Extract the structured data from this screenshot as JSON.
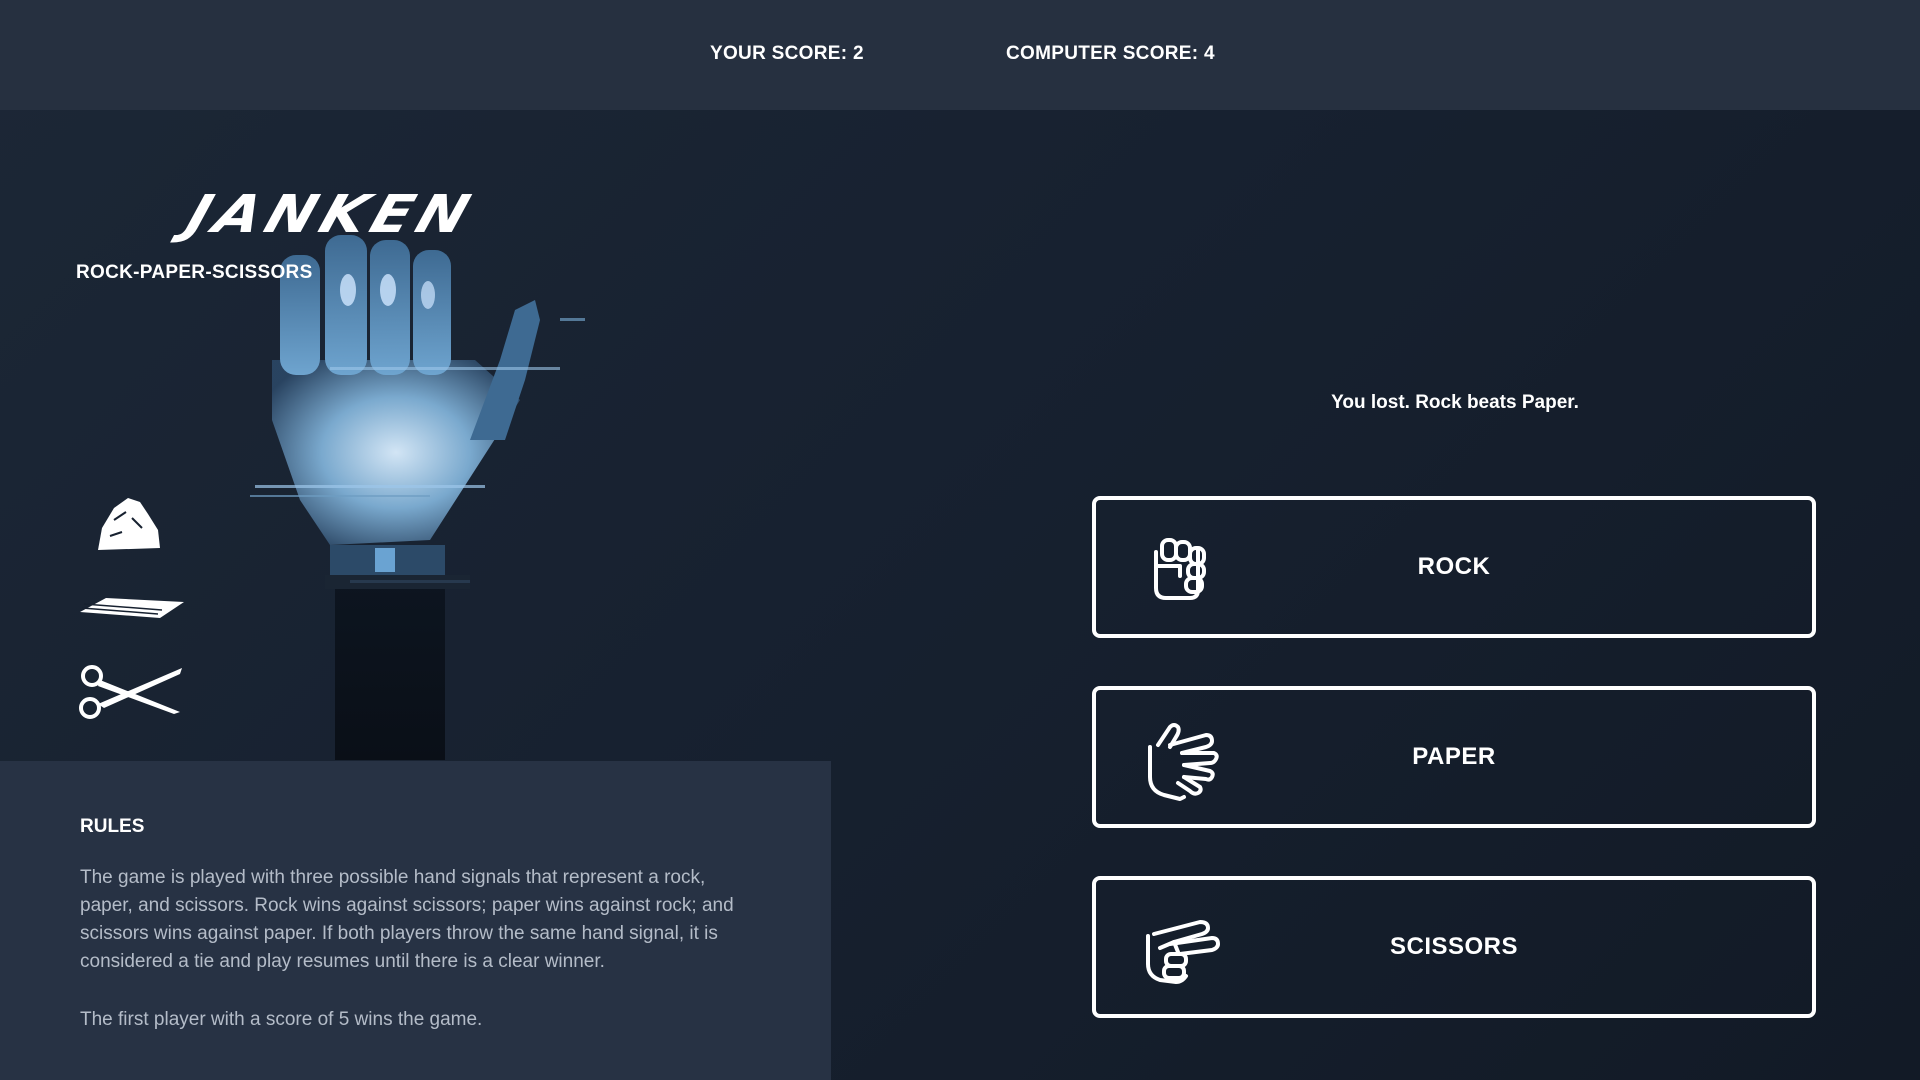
{
  "header": {
    "your_score_label": "YOUR SCORE: 2",
    "computer_score_label": "COMPUTER SCORE: 4"
  },
  "hero": {
    "logo_text": "JANKEN",
    "subtitle": "ROCK-PAPER-SCISSORS",
    "icons": [
      "rock-icon",
      "paper-icon",
      "scissors-icon"
    ]
  },
  "rules": {
    "title": "RULES",
    "paragraph_1": "The game is played with three possible hand signals that represent a rock, paper, and scissors. Rock wins against scissors; paper wins against rock; and scissors wins against paper. If both players throw the same hand signal, it is considered a tie and play resumes until there is a clear winner.",
    "paragraph_2": "The first player with a score of 5 wins the game."
  },
  "game": {
    "result_message": "You lost. Rock beats Paper.",
    "buttons": [
      {
        "label": "ROCK",
        "icon": "fist-icon"
      },
      {
        "label": "PAPER",
        "icon": "open-hand-icon"
      },
      {
        "label": "SCISSORS",
        "icon": "scissors-hand-icon"
      }
    ]
  },
  "colors": {
    "background": "#172130",
    "topbar": "#263040",
    "rules_panel": "#283345",
    "text": "#ffffff",
    "muted_text": "#b4bcc8"
  }
}
